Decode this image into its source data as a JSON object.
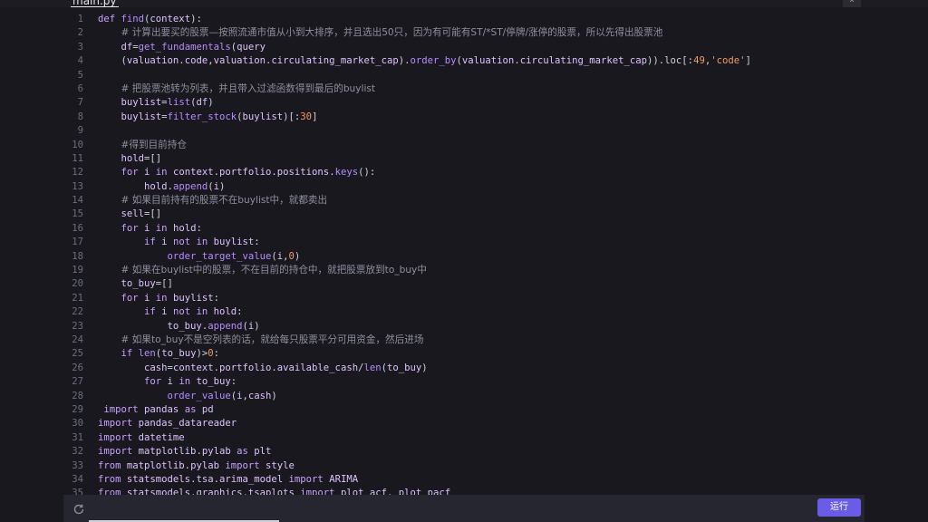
{
  "file_tab": "main.py",
  "run_label": "运行",
  "lines": [
    {
      "n": "1",
      "segs": [
        [
          "kw",
          "def "
        ],
        [
          "fn",
          "find"
        ],
        [
          "pl",
          "("
        ],
        [
          "var",
          "context"
        ],
        [
          "pl",
          "):"
        ]
      ]
    },
    {
      "n": "2",
      "segs": [
        [
          "pl",
          "    "
        ],
        [
          "cm",
          "# 计算出要买的股票—按照流通市值从小到大排序，并且选出50只，因为有可能有ST/*ST/停牌/涨停的股票，所以先得出股票池"
        ]
      ]
    },
    {
      "n": "3",
      "segs": [
        [
          "pl",
          "    "
        ],
        [
          "var",
          "df"
        ],
        [
          "pl",
          "="
        ],
        [
          "fn",
          "get_fundamentals"
        ],
        [
          "pl",
          "("
        ],
        [
          "var",
          "query"
        ]
      ]
    },
    {
      "n": "4",
      "segs": [
        [
          "pl",
          "    ("
        ],
        [
          "var",
          "valuation"
        ],
        [
          "pl",
          "."
        ],
        [
          "var",
          "code"
        ],
        [
          "pl",
          ","
        ],
        [
          "var",
          "valuation"
        ],
        [
          "pl",
          "."
        ],
        [
          "var",
          "circulating_market_cap"
        ],
        [
          "pl",
          ")."
        ],
        [
          "fn",
          "order_by"
        ],
        [
          "pl",
          "("
        ],
        [
          "var",
          "valuation"
        ],
        [
          "pl",
          "."
        ],
        [
          "var",
          "circulating_market_cap"
        ],
        [
          "pl",
          ")).loc[:"
        ],
        [
          "num",
          "49"
        ],
        [
          "pl",
          ","
        ],
        [
          "str",
          "'code'"
        ],
        [
          "pl",
          "]"
        ]
      ]
    },
    {
      "n": "5",
      "segs": []
    },
    {
      "n": "6",
      "segs": [
        [
          "pl",
          "    "
        ],
        [
          "cm",
          "# 把股票池转为列表，并且带入过滤函数得到最后的buylist"
        ]
      ]
    },
    {
      "n": "7",
      "segs": [
        [
          "pl",
          "    "
        ],
        [
          "var",
          "buylist"
        ],
        [
          "pl",
          "="
        ],
        [
          "fn",
          "list"
        ],
        [
          "pl",
          "("
        ],
        [
          "var",
          "df"
        ],
        [
          "pl",
          ")"
        ]
      ]
    },
    {
      "n": "8",
      "segs": [
        [
          "pl",
          "    "
        ],
        [
          "var",
          "buylist"
        ],
        [
          "pl",
          "="
        ],
        [
          "fn",
          "filter_stock"
        ],
        [
          "pl",
          "("
        ],
        [
          "var",
          "buylist"
        ],
        [
          "pl",
          ")[:"
        ],
        [
          "num",
          "30"
        ],
        [
          "pl",
          "]"
        ]
      ]
    },
    {
      "n": "9",
      "segs": []
    },
    {
      "n": "10",
      "segs": [
        [
          "pl",
          "    "
        ],
        [
          "cm",
          "#得到目前持仓"
        ]
      ]
    },
    {
      "n": "11",
      "segs": [
        [
          "pl",
          "    "
        ],
        [
          "var",
          "hold"
        ],
        [
          "pl",
          "=[]"
        ]
      ]
    },
    {
      "n": "12",
      "segs": [
        [
          "pl",
          "    "
        ],
        [
          "kw",
          "for "
        ],
        [
          "var",
          "i"
        ],
        [
          "kw",
          " in "
        ],
        [
          "var",
          "context"
        ],
        [
          "pl",
          "."
        ],
        [
          "var",
          "portfolio"
        ],
        [
          "pl",
          "."
        ],
        [
          "var",
          "positions"
        ],
        [
          "pl",
          "."
        ],
        [
          "fn",
          "keys"
        ],
        [
          "pl",
          "():"
        ]
      ]
    },
    {
      "n": "13",
      "segs": [
        [
          "pl",
          "        "
        ],
        [
          "var",
          "hold"
        ],
        [
          "pl",
          "."
        ],
        [
          "fn",
          "append"
        ],
        [
          "pl",
          "("
        ],
        [
          "var",
          "i"
        ],
        [
          "pl",
          ")"
        ]
      ]
    },
    {
      "n": "14",
      "segs": [
        [
          "pl",
          "    "
        ],
        [
          "cm",
          "# 如果目前持有的股票不在buylist中，就都卖出"
        ]
      ]
    },
    {
      "n": "15",
      "segs": [
        [
          "pl",
          "    "
        ],
        [
          "var",
          "sell"
        ],
        [
          "pl",
          "=[]"
        ]
      ]
    },
    {
      "n": "16",
      "segs": [
        [
          "pl",
          "    "
        ],
        [
          "kw",
          "for "
        ],
        [
          "var",
          "i"
        ],
        [
          "kw",
          " in "
        ],
        [
          "var",
          "hold"
        ],
        [
          "pl",
          ":"
        ]
      ]
    },
    {
      "n": "17",
      "segs": [
        [
          "pl",
          "        "
        ],
        [
          "kw",
          "if "
        ],
        [
          "var",
          "i"
        ],
        [
          "kw",
          " not in "
        ],
        [
          "var",
          "buylist"
        ],
        [
          "pl",
          ":"
        ]
      ]
    },
    {
      "n": "18",
      "segs": [
        [
          "pl",
          "            "
        ],
        [
          "fn",
          "order_target_value"
        ],
        [
          "pl",
          "("
        ],
        [
          "var",
          "i"
        ],
        [
          "pl",
          ","
        ],
        [
          "num",
          "0"
        ],
        [
          "pl",
          ")"
        ]
      ]
    },
    {
      "n": "19",
      "segs": [
        [
          "pl",
          "    "
        ],
        [
          "cm",
          "# 如果在buylist中的股票，不在目前的持仓中，就把股票放到to_buy中"
        ]
      ]
    },
    {
      "n": "20",
      "segs": [
        [
          "pl",
          "    "
        ],
        [
          "var",
          "to_buy"
        ],
        [
          "pl",
          "=[]"
        ]
      ]
    },
    {
      "n": "21",
      "segs": [
        [
          "pl",
          "    "
        ],
        [
          "kw",
          "for "
        ],
        [
          "var",
          "i"
        ],
        [
          "kw",
          " in "
        ],
        [
          "var",
          "buylist"
        ],
        [
          "pl",
          ":"
        ]
      ]
    },
    {
      "n": "22",
      "segs": [
        [
          "pl",
          "        "
        ],
        [
          "kw",
          "if "
        ],
        [
          "var",
          "i"
        ],
        [
          "kw",
          " not in "
        ],
        [
          "var",
          "hold"
        ],
        [
          "pl",
          ":"
        ]
      ]
    },
    {
      "n": "23",
      "segs": [
        [
          "pl",
          "            "
        ],
        [
          "var",
          "to_buy"
        ],
        [
          "pl",
          "."
        ],
        [
          "fn",
          "append"
        ],
        [
          "pl",
          "("
        ],
        [
          "var",
          "i"
        ],
        [
          "pl",
          ")"
        ]
      ]
    },
    {
      "n": "24",
      "segs": [
        [
          "pl",
          "    "
        ],
        [
          "cm",
          "# 如果to_buy不是空列表的话，就给每只股票平分可用资金，然后进场"
        ]
      ]
    },
    {
      "n": "25",
      "segs": [
        [
          "pl",
          "    "
        ],
        [
          "kw",
          "if "
        ],
        [
          "fn",
          "len"
        ],
        [
          "pl",
          "("
        ],
        [
          "var",
          "to_buy"
        ],
        [
          "pl",
          ")>"
        ],
        [
          "num",
          "0"
        ],
        [
          "pl",
          ":"
        ]
      ]
    },
    {
      "n": "26",
      "segs": [
        [
          "pl",
          "        "
        ],
        [
          "var",
          "cash"
        ],
        [
          "pl",
          "="
        ],
        [
          "var",
          "context"
        ],
        [
          "pl",
          "."
        ],
        [
          "var",
          "portfolio"
        ],
        [
          "pl",
          "."
        ],
        [
          "var",
          "available_cash"
        ],
        [
          "pl",
          "/"
        ],
        [
          "fn",
          "len"
        ],
        [
          "pl",
          "("
        ],
        [
          "var",
          "to_buy"
        ],
        [
          "pl",
          ")"
        ]
      ]
    },
    {
      "n": "27",
      "segs": [
        [
          "pl",
          "        "
        ],
        [
          "kw",
          "for "
        ],
        [
          "var",
          "i"
        ],
        [
          "kw",
          " in "
        ],
        [
          "var",
          "to_buy"
        ],
        [
          "pl",
          ":"
        ]
      ]
    },
    {
      "n": "28",
      "segs": [
        [
          "pl",
          "            "
        ],
        [
          "fn",
          "order_value"
        ],
        [
          "pl",
          "("
        ],
        [
          "var",
          "i"
        ],
        [
          "pl",
          ","
        ],
        [
          "var",
          "cash"
        ],
        [
          "pl",
          ")"
        ]
      ]
    },
    {
      "n": "29",
      "segs": [
        [
          "pl",
          " "
        ],
        [
          "kw",
          "import "
        ],
        [
          "var",
          "pandas"
        ],
        [
          "kw",
          " as "
        ],
        [
          "var",
          "pd"
        ]
      ]
    },
    {
      "n": "30",
      "segs": [
        [
          "kw",
          "import "
        ],
        [
          "var",
          "pandas_datareader"
        ]
      ]
    },
    {
      "n": "31",
      "segs": [
        [
          "kw",
          "import "
        ],
        [
          "var",
          "datetime"
        ]
      ]
    },
    {
      "n": "32",
      "segs": [
        [
          "kw",
          "import "
        ],
        [
          "var",
          "matplotlib"
        ],
        [
          "pl",
          "."
        ],
        [
          "var",
          "pylab"
        ],
        [
          "kw",
          " as "
        ],
        [
          "var",
          "plt"
        ]
      ]
    },
    {
      "n": "33",
      "segs": [
        [
          "kw",
          "from "
        ],
        [
          "var",
          "matplotlib"
        ],
        [
          "pl",
          "."
        ],
        [
          "var",
          "pylab"
        ],
        [
          "kw",
          " import "
        ],
        [
          "var",
          "style"
        ]
      ]
    },
    {
      "n": "34",
      "segs": [
        [
          "kw",
          "from "
        ],
        [
          "var",
          "statsmodels"
        ],
        [
          "pl",
          "."
        ],
        [
          "var",
          "tsa"
        ],
        [
          "pl",
          "."
        ],
        [
          "var",
          "arima_model"
        ],
        [
          "kw",
          " import "
        ],
        [
          "var",
          "ARIMA"
        ]
      ]
    },
    {
      "n": "35",
      "segs": [
        [
          "kw",
          "from "
        ],
        [
          "var",
          "statsmodels"
        ],
        [
          "pl",
          "."
        ],
        [
          "var",
          "graphics"
        ],
        [
          "pl",
          "."
        ],
        [
          "var",
          "tsaplots"
        ],
        [
          "kw",
          " import "
        ],
        [
          "var",
          "plot_acf"
        ],
        [
          "pl",
          ", "
        ],
        [
          "var",
          "plot_pacf"
        ]
      ]
    }
  ]
}
